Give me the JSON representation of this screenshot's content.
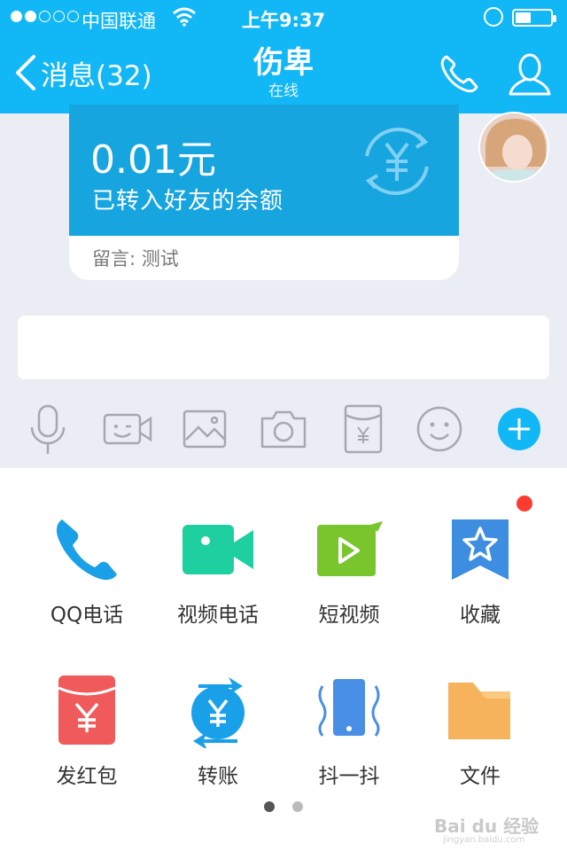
{
  "status_bar": {
    "carrier": "中国联通",
    "time": "上午9:37",
    "signal_dots_filled": 2,
    "signal_dots_total": 5,
    "battery_level": 0.45
  },
  "nav": {
    "back_label": "消息(32)",
    "title": "伤卑",
    "subtitle": "在线",
    "call_icon": "phone-icon",
    "profile_icon": "person-icon"
  },
  "transfer_card": {
    "amount": "0.01元",
    "description": "已转入好友的余额",
    "note_label": "留言:",
    "note_text": "测试",
    "icon": "yen-refresh-icon"
  },
  "input": {
    "value": "",
    "placeholder": ""
  },
  "toolbar": [
    {
      "icon": "microphone-icon"
    },
    {
      "icon": "video-icon"
    },
    {
      "icon": "image-icon"
    },
    {
      "icon": "camera-icon"
    },
    {
      "icon": "red-packet-icon"
    },
    {
      "icon": "emoji-icon"
    },
    {
      "icon": "plus-icon"
    }
  ],
  "panel": {
    "items": [
      {
        "label": "QQ电话",
        "icon": "phone-icon"
      },
      {
        "label": "视频电话",
        "icon": "video-camera-icon"
      },
      {
        "label": "短视频",
        "icon": "short-video-icon"
      },
      {
        "label": "收藏",
        "icon": "favorite-icon",
        "badge": true
      },
      {
        "label": "发红包",
        "icon": "red-packet-icon"
      },
      {
        "label": "转账",
        "icon": "transfer-icon"
      },
      {
        "label": "抖一抖",
        "icon": "shake-icon"
      },
      {
        "label": "文件",
        "icon": "folder-icon"
      }
    ],
    "page_count": 2,
    "active_page": 1
  },
  "watermark": {
    "logo": "Bai du 经验",
    "url": "jingyan.baidu.com"
  },
  "colors": {
    "header": "#12b7f5",
    "card": "#17a5e0",
    "chat_bg": "#ebedf5",
    "plus": "#12b7f5",
    "phone": "#1aa0e8",
    "video": "#1ecfa0",
    "short_video": "#78c52d",
    "favorite": "#3d8de0",
    "red_packet": "#f15a5a",
    "shake": "#4a8fe6",
    "folder": "#f6b35b"
  }
}
